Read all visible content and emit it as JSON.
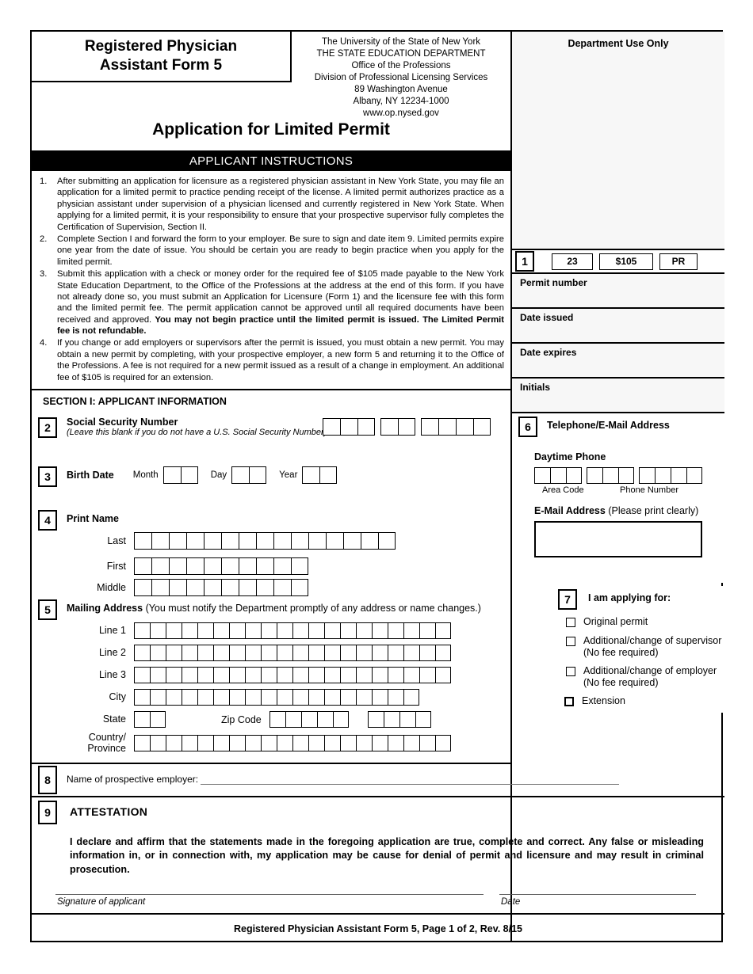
{
  "form": {
    "title_line1": "Registered Physician",
    "title_line2": "Assistant Form 5",
    "application_title": "Application for Limited Permit",
    "footer": "Registered Physician Assistant Form 5, Page 1 of 2, Rev. 8/15"
  },
  "agency": {
    "line1": "The University of the State of New York",
    "line2": "THE STATE EDUCATION DEPARTMENT",
    "line3": "Office of the Professions",
    "line4": "Division of Professional Licensing Services",
    "line5": "89 Washington Avenue",
    "line6": "Albany, NY 12234-1000",
    "line7": "www.op.nysed.gov"
  },
  "instructions": {
    "heading": "APPLICANT INSTRUCTIONS",
    "items": [
      {
        "num": "1.",
        "text": "After submitting an application for licensure as a registered physician assistant in New York State, you may file an application for a limited permit to practice pending receipt of the license. A limited permit authorizes practice as a physician assistant under supervision of a physician licensed and currently registered in New York State. When applying for a limited permit, it is your responsibility to ensure that your prospective supervisor fully completes the Certification of Supervision, Section II."
      },
      {
        "num": "2.",
        "text": "Complete Section I and forward the form to your employer. Be sure to sign and date item 9. Limited permits expire one year from the date of issue. You should be certain you are ready to begin practice when you apply for the limited permit."
      },
      {
        "num": "3.",
        "text": "Submit this application with a check or money order for the required fee of $105 made payable to the New York State Education Department, to the Office of the Professions at the address at the end of this form. If you have not already done so, you must submit an Application for Licensure (Form 1) and the licensure fee with this form and the limited permit fee. The permit application cannot be approved until all required documents have been received and approved. ",
        "bold_tail": "You may not begin practice until the limited permit is issued. The Limited Permit fee is not refundable."
      },
      {
        "num": "4.",
        "text": "If you change or add employers or supervisors after the permit is issued, you must obtain a new permit. You may obtain a new permit by completing, with your prospective employer, a new form 5 and returning it to the Office of the Professions. A fee is not required for a new permit issued as a result of a change in employment. An additional fee of $105 is required for an extension."
      }
    ]
  },
  "department_use": {
    "heading": "Department Use Only",
    "item_number": "1",
    "code": "23",
    "fee": "$105",
    "prefix": "PR",
    "fields": [
      {
        "label": "Permit number"
      },
      {
        "label": "Date issued"
      },
      {
        "label": "Date expires"
      },
      {
        "label": "Initials"
      }
    ]
  },
  "section1": {
    "heading": "SECTION I: APPLICANT INFORMATION",
    "ssn": {
      "num": "2",
      "label": "Social Security Number",
      "note": "(Leave this blank if you do not have a U.S. Social Security Number)",
      "groups": [
        3,
        2,
        4
      ]
    },
    "birth_date": {
      "num": "3",
      "label": "Birth Date",
      "parts": [
        {
          "label": "Month",
          "cells": 2
        },
        {
          "label": "Day",
          "cells": 2
        },
        {
          "label": "Year",
          "cells": 2
        }
      ]
    },
    "print_name": {
      "num": "4",
      "label": "Print Name",
      "rows": [
        {
          "label": "Last",
          "cells": 15
        },
        {
          "label": "First",
          "cells": 10
        },
        {
          "label": "Middle",
          "cells": 10
        }
      ]
    },
    "mailing_address": {
      "num": "5",
      "label": "Mailing Address",
      "note": "(You must notify the Department promptly of any address or name changes.)",
      "rows": [
        {
          "label": "Line 1",
          "cells": 20
        },
        {
          "label": "Line 2",
          "cells": 20
        },
        {
          "label": "Line 3",
          "cells": 20
        },
        {
          "label": "City",
          "cells": 18
        }
      ],
      "state_label": "State",
      "state_cells": 2,
      "zip_label": "Zip Code",
      "zip_cells": 5,
      "zip_plus4_cells": 4,
      "country_label_line1": "Country/",
      "country_label_line2": "Province",
      "country_cells": 20
    }
  },
  "section6": {
    "num": "6",
    "heading": "Telephone/E-Mail Address",
    "phone_label": "Daytime Phone",
    "phone_groups": [
      3,
      3,
      4
    ],
    "area_code_caption": "Area Code",
    "phone_number_caption": "Phone Number",
    "email_label": "E-Mail Address",
    "email_note": "(Please print clearly)"
  },
  "section7": {
    "num": "7",
    "heading": "I am applying for:",
    "options": [
      {
        "label": "Original permit",
        "sub": ""
      },
      {
        "label": "Additional/change of supervisor",
        "sub": "(No fee required)"
      },
      {
        "label": "Additional/change of employer",
        "sub": "(No fee required)"
      },
      {
        "label": "Extension",
        "sub": ""
      }
    ]
  },
  "section8": {
    "num": "8",
    "label": "Name of prospective employer:"
  },
  "section9": {
    "num": "9",
    "heading": "ATTESTATION",
    "body": "I declare and affirm that the statements made in the foregoing application are true, complete and correct. Any false or misleading information in, or in connection with, my application may be cause for denial of permit and licensure and may result in criminal prosecution.",
    "signature_caption": "Signature of applicant",
    "date_caption": "Date"
  },
  "colors": {
    "ink": "#000000",
    "dept_panel": "#f7f7f7",
    "rule": "#555555"
  }
}
